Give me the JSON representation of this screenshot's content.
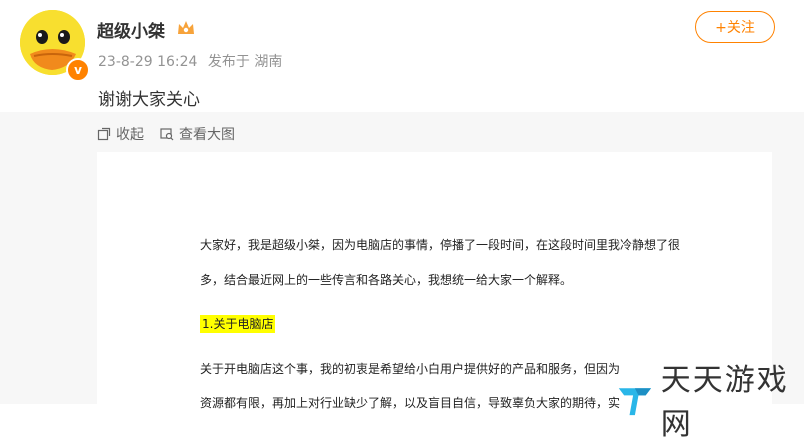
{
  "user": {
    "name": "超级小桀",
    "verified_symbol": "v"
  },
  "post": {
    "meta": {
      "time": "23-8-29 16:24",
      "source": "发布于 湖南"
    },
    "text": "谢谢大家关心"
  },
  "follow_label": "+关注",
  "toolbar": {
    "collapse_label": "收起",
    "view_large_label": "查看大图"
  },
  "document": {
    "line1": "大家好，我是超级小桀，因为电脑店的事情，停播了一段时间，在这段时间里我冷静想了很",
    "line2": "多，结合最近网上的一些传言和各路关心，我想统一给大家一个解释。",
    "heading": "1.关于电脑店",
    "line3": "关于开电脑店这个事，我的初衷是希望给小白用户提供好的产品和服务，但因为",
    "line4": "资源都有限，再加上对行业缺少了解，以及盲目自信，导致辜负大家的期待，实"
  },
  "watermark": {
    "text": "天天游戏网"
  },
  "colors": {
    "accent": "#ff8200",
    "highlight": "#ffff00",
    "avatar": "#f8df2f"
  }
}
